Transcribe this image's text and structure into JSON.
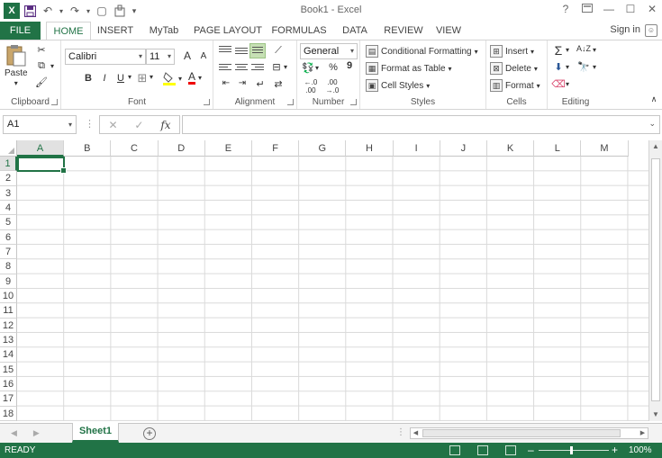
{
  "window": {
    "title": "Book1 - Excel",
    "help": "?",
    "restore_icon": "ribbon-display-icon",
    "minimize": "—",
    "maximize": "☐",
    "close": "✕"
  },
  "qat": {
    "app_icon": "X",
    "save": "💾",
    "undo": "↶",
    "redo": "↷",
    "new": "▢",
    "touch": "✋",
    "customize": "▾"
  },
  "tabs": [
    "FILE",
    "HOME",
    "INSERT",
    "MyTab",
    "PAGE LAYOUT",
    "FORMULAS",
    "DATA",
    "REVIEW",
    "VIEW"
  ],
  "account": {
    "sign_in": "Sign in"
  },
  "ribbon": {
    "clipboard": {
      "label": "Clipboard",
      "paste": "Paste"
    },
    "font": {
      "label": "Font",
      "name": "Calibri",
      "size": "11",
      "grow": "A",
      "shrink": "A",
      "bold": "B",
      "italic": "I",
      "underline": "U",
      "font_color": "A"
    },
    "alignment": {
      "label": "Alignment"
    },
    "number": {
      "label": "Number",
      "format": "General",
      "percent": "%",
      "comma": "9"
    },
    "styles": {
      "label": "Styles",
      "conditional": "Conditional Formatting",
      "table": "Format as Table",
      "cell_styles": "Cell Styles"
    },
    "cells": {
      "label": "Cells",
      "insert": "Insert",
      "delete": "Delete",
      "format": "Format"
    },
    "editing": {
      "label": "Editing"
    }
  },
  "formula_bar": {
    "name_box": "A1",
    "dots": "⋮",
    "cancel": "✕",
    "enter": "✓",
    "fx": "fx",
    "value": ""
  },
  "columns": [
    "A",
    "B",
    "C",
    "D",
    "E",
    "F",
    "G",
    "H",
    "I",
    "J",
    "K",
    "L",
    "M"
  ],
  "rows": [
    "1",
    "2",
    "3",
    "4",
    "5",
    "6",
    "7",
    "8",
    "9",
    "10",
    "11",
    "12",
    "13",
    "14",
    "15",
    "16",
    "17",
    "18"
  ],
  "sheets": {
    "active": "Sheet1",
    "add": "+"
  },
  "status": {
    "text": "READY",
    "zoom": "100%",
    "zoom_minus": "–",
    "zoom_plus": "+"
  }
}
